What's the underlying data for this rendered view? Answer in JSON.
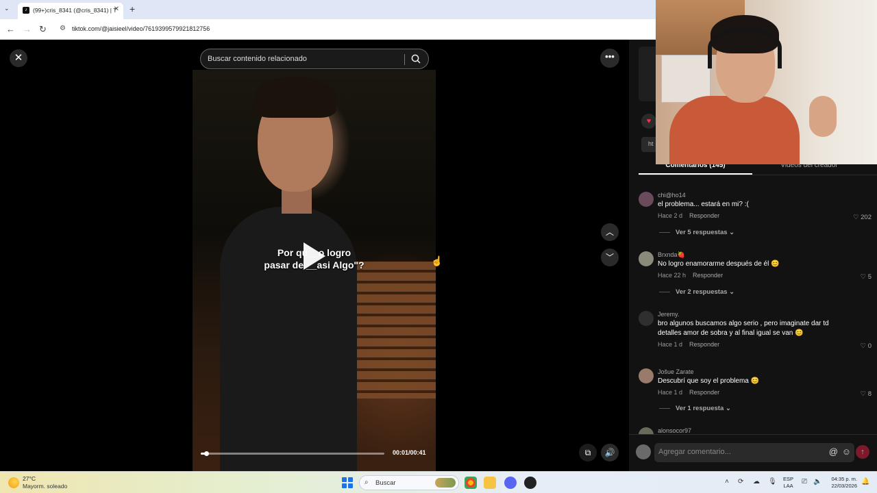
{
  "browser": {
    "tab_title": "(99+)cris_8341 (@cris_8341) | T",
    "url": "tiktok.com/@jaisieel/video/7619399579921812756"
  },
  "player": {
    "search_placeholder": "Buscar contenido relacionado",
    "caption": "Por qu__o logro\npasar de __asi Algo\"?",
    "time": "00:01/00:41",
    "progress": 0.03
  },
  "panel": {
    "link_prefix": "ht",
    "tabs": [
      "Comentarios (145)",
      "Videos del creador"
    ],
    "reply_label": "Responder",
    "comments": [
      {
        "user": "chi@ho14",
        "text": "el problema... estará en mi? :(",
        "time": "Hace 2 d",
        "likes": "202",
        "replies": "Ver 5 respuestas",
        "avatar_color": "#6b4a5c"
      },
      {
        "user": "Brxnda🍓",
        "text": "No logro enamorarme después de él 😊",
        "time": "Hace 22 h",
        "likes": "5",
        "replies": "Ver 2 respuestas",
        "avatar_color": "#8a8a7a"
      },
      {
        "user": "Jeremy.",
        "text": "bro algunos buscamos algo serio , pero imaginate dar td detalles amor de sobra y al final igual se van 😊",
        "time": "Hace 1 d",
        "likes": "0",
        "replies": "",
        "avatar_color": "#2f2f2f"
      },
      {
        "user": "Jošue Zarate",
        "text": "Descubrí que soy el problema 😊",
        "time": "Hace 1 d",
        "likes": "8",
        "replies": "Ver 1 respuesta",
        "avatar_color": "#9a7a6a"
      },
      {
        "user": "alonsocor97",
        "text": "",
        "time": "",
        "likes": "",
        "replies": "",
        "avatar_color": "#6a6a5a"
      }
    ],
    "composer_placeholder": "Agregar comentario..."
  },
  "taskbar": {
    "temp": "27°C",
    "weather": "Mayorm. soleado",
    "search": "Buscar",
    "lang_top": "ESP",
    "lang_bottom": "LAA",
    "time": "04:35 p. m.",
    "date": "22/03/2026"
  },
  "colors": {
    "accent": "#fe2c55",
    "panel_bg": "#121212"
  }
}
